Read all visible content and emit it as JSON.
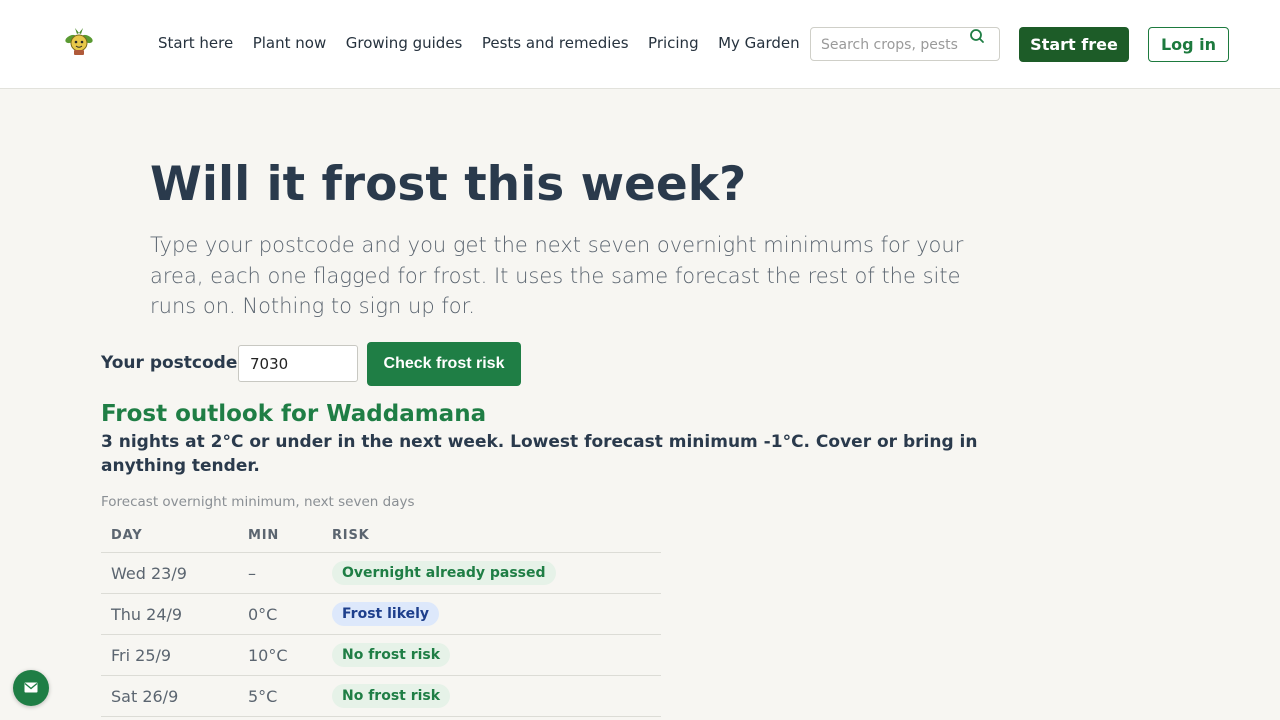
{
  "header": {
    "logo_icon": "seedling-face-logo-icon",
    "nav": [
      "Start here",
      "Plant now",
      "Growing guides",
      "Pests and remedies",
      "Pricing",
      "My Garden"
    ],
    "search": {
      "placeholder": "Search crops, pests",
      "icon": "search-icon"
    },
    "start_free_label": "Start free",
    "login_label": "Log in"
  },
  "main": {
    "title": "Will it frost this week?",
    "intro": "Type your postcode and you get the next seven overnight minimums for your area, each one flagged for frost. It uses the same forecast the rest of the site runs on. Nothing to sign up for.",
    "form": {
      "label": "Your postcode",
      "postcode_value": "7030",
      "submit_label": "Check frost risk"
    },
    "outlook": {
      "title": "Frost outlook for Waddamana",
      "summary": "3 nights at 2°C or under in the next week. Lowest forecast minimum -1°C. Cover or bring in anything tender.",
      "caption": "Forecast overnight minimum, next seven days",
      "columns": [
        "DAY",
        "MIN",
        "RISK"
      ],
      "rows": [
        {
          "day": "Wed 23/9",
          "min": "–",
          "risk": "Overnight already passed",
          "risk_type": "ok"
        },
        {
          "day": "Thu 24/9",
          "min": "0°C",
          "risk": "Frost likely",
          "risk_type": "frost"
        },
        {
          "day": "Fri 25/9",
          "min": "10°C",
          "risk": "No frost risk",
          "risk_type": "ok"
        },
        {
          "day": "Sat 26/9",
          "min": "5°C",
          "risk": "No frost risk",
          "risk_type": "ok"
        }
      ]
    }
  },
  "chat_widget": {
    "icon": "envelope-icon"
  },
  "colors": {
    "brand_green": "#1f7e45",
    "brand_dark_green": "#1d5c28",
    "frost_badge_bg": "#dde8fb",
    "frost_badge_text": "#1e3f8c",
    "ok_badge_bg": "#e6f2e8",
    "page_bg": "#f7f6f2",
    "heading": "#2a3a4c"
  }
}
